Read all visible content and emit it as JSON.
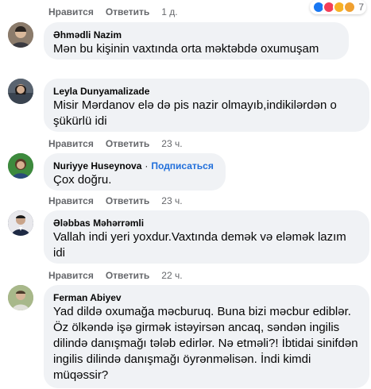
{
  "top_actions": {
    "like": "Нравится",
    "reply": "Ответить",
    "time": "1 д."
  },
  "reactions": {
    "count": "7"
  },
  "comments": [
    {
      "author": "Əhmədli Nazim",
      "text": "Mən bu kişinin vaxtında orta məktəbdə oxumuşam",
      "avatar_color": "#7a6a5a"
    },
    {
      "author": "Leyla Dunyamalizade",
      "text": "Misir Mərdanov elə də pis nazir olmayıb,indikilərdən o şükürlü idi",
      "like": "Нравится",
      "reply": "Ответить",
      "time": "23 ч.",
      "avatar_color": "#4a5a6a"
    },
    {
      "author": "Nuriyye Huseynova",
      "subscribe": "Подписаться",
      "text": "Çox doğru.",
      "like": "Нравится",
      "reply": "Ответить",
      "time": "23 ч.",
      "avatar_color": "#2f7a3a"
    },
    {
      "author": "Ələbbas Məhərrəmli",
      "text": "Vallah indi yeri yoxdur.Vaxtında demək və eləmək lazım idi",
      "like": "Нравится",
      "reply": "Ответить",
      "time": "22 ч.",
      "avatar_color": "#2b3550"
    },
    {
      "author": "Ferman Abiyev",
      "text": "Yad dildə oxumağa məcburuq. Buna bizi məcbur ediblər. Öz ölkəndə işə girmək istəyirsən ancaq, səndən ingilis dilində danışmağı tələb edirlər. Nə etməli?! İbtidai sinifdən ingilis dilində danışmağı öyrənməlisən. İndi kimdi müqəssir?",
      "avatar_color": "#8a9a6a"
    }
  ]
}
